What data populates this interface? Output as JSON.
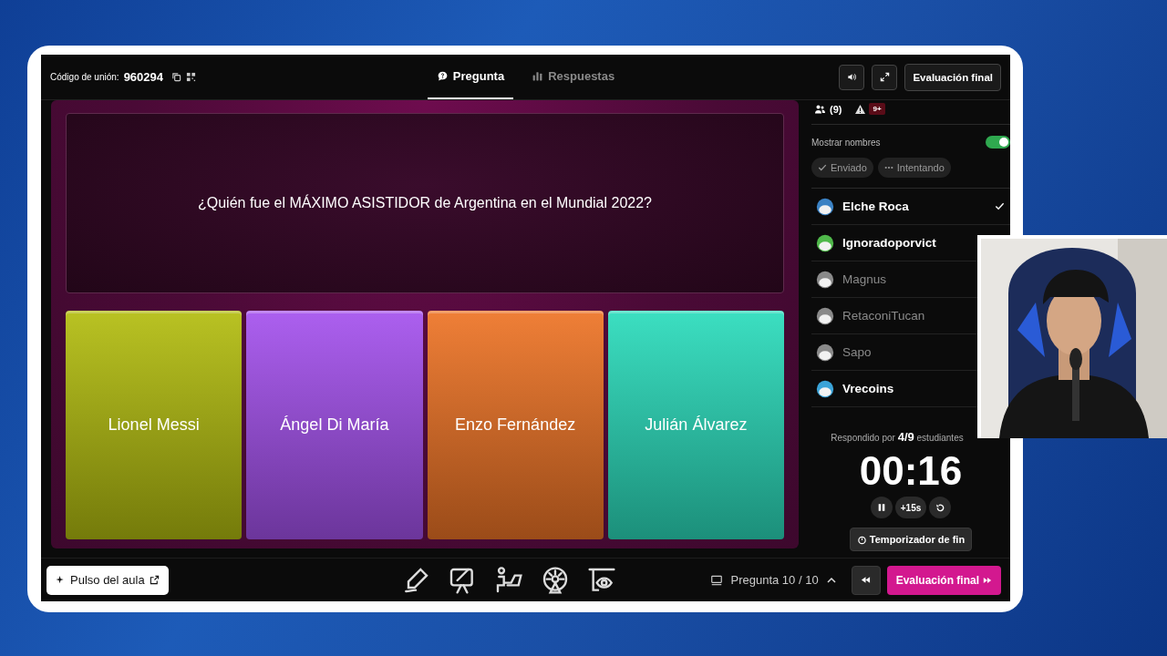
{
  "header": {
    "join_code_label": "Código de unión:",
    "join_code": "960294",
    "tabs": [
      {
        "label": "Pregunta",
        "kind": "question",
        "selected": true
      },
      {
        "label": "Respuestas",
        "kind": "answers",
        "selected": false
      }
    ],
    "final_button": "Evaluación final"
  },
  "question": "¿Quién fue el MÁXIMO ASISTIDOR de Argentina en el Mundial 2022?",
  "answers": [
    {
      "text": "Lionel Messi",
      "color": "#b3bd10"
    },
    {
      "text": "Ángel Di María",
      "color": "#a552ee"
    },
    {
      "text": "Enzo Fernández",
      "color": "#ee7426"
    },
    {
      "text": "Julián Álvarez",
      "color": "#2bdcbc"
    }
  ],
  "panel": {
    "participants": "(9)",
    "alerts": "9+",
    "show_names": {
      "label": "Mostrar nombres",
      "on": true
    },
    "filters": [
      {
        "label": "Enviado",
        "kind": "check"
      },
      {
        "label": "Intentando",
        "kind": "dots"
      }
    ],
    "students": [
      {
        "name": "Elche Roca",
        "active": true,
        "submitted": true,
        "color": "#3b82c4"
      },
      {
        "name": "Ignoradoporvict",
        "active": true,
        "color": "#4fb84a"
      },
      {
        "name": "Magnus",
        "active": false,
        "color": "#8a8a8a"
      },
      {
        "name": "RetaconiTucan",
        "active": false,
        "color": "#8a8a8a"
      },
      {
        "name": "Sapo",
        "active": false,
        "color": "#8a8a8a"
      },
      {
        "name": "Vrecoins",
        "active": true,
        "color": "#3aa3d8"
      }
    ],
    "responded": "Respondido por **4/9** estudiantes",
    "timer": "00:16",
    "add_time": "+15s",
    "end_timer": "Temporizador de fin"
  },
  "footer": {
    "pulse": "Pulso del aula",
    "counter": "Pregunta 10 / 10",
    "final_button": "Evaluación final"
  }
}
